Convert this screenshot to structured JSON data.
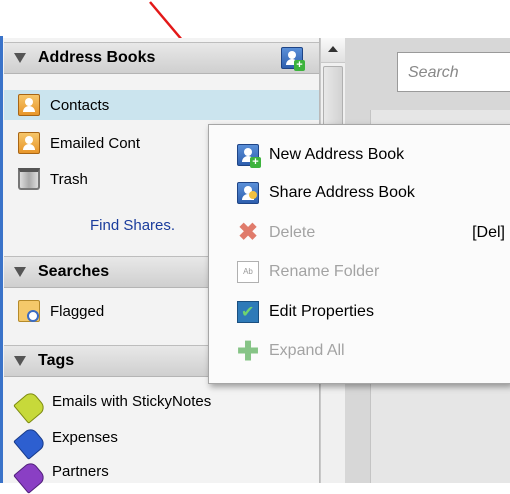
{
  "address_books_header": "Address Books",
  "address_books": [
    {
      "label": "Contacts",
      "icon": "address-book-icon",
      "selected": true
    },
    {
      "label": "Emailed Cont",
      "icon": "emailed-contacts-icon"
    },
    {
      "label": "Trash",
      "icon": "trash-icon"
    }
  ],
  "find_shares": "Find Shares.",
  "searches_header": "Searches",
  "searches": [
    {
      "label": "Flagged",
      "icon": "search-folder-icon"
    }
  ],
  "tags_header": "Tags",
  "tags": [
    {
      "label": "Emails with StickyNotes",
      "icon": "tag-icon",
      "color": "#c7d93a"
    },
    {
      "label": "Expenses",
      "icon": "tag-icon",
      "color": "#2d5fd0"
    },
    {
      "label": "Partners",
      "icon": "tag-icon",
      "color": "#8a3fc4"
    }
  ],
  "search": {
    "placeholder": "Search"
  },
  "context_menu": [
    {
      "label": "New Address Book",
      "icon": "new-address-book-icon",
      "enabled": true
    },
    {
      "label": "Share Address Book",
      "icon": "share-address-book-icon",
      "enabled": true
    },
    {
      "label": "Delete",
      "icon": "delete-icon",
      "enabled": false,
      "shortcut": "[Del]"
    },
    {
      "label": "Rename Folder",
      "icon": "rename-icon",
      "enabled": false
    },
    {
      "label": "Edit Properties",
      "icon": "edit-properties-icon",
      "enabled": true
    },
    {
      "label": "Expand All",
      "icon": "expand-icon",
      "enabled": false
    }
  ],
  "colors": {
    "accent": "#3a73c9",
    "arrow": "#e31818",
    "selected_row": "#cbe4ee"
  }
}
